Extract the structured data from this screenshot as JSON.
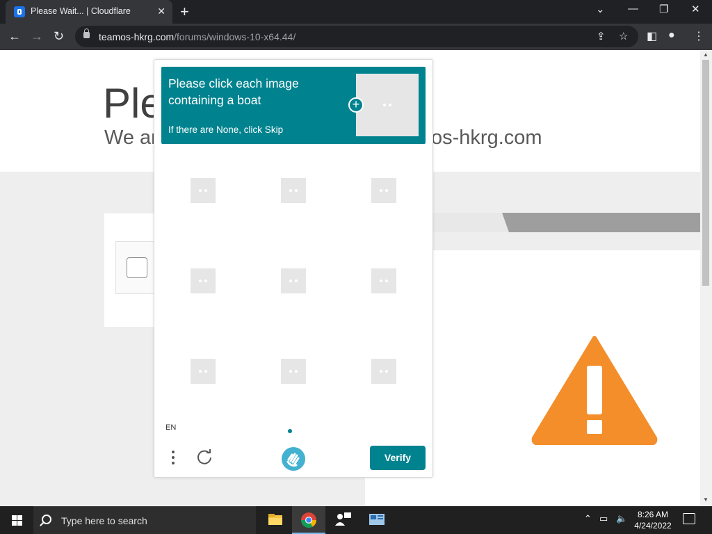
{
  "browser": {
    "tab_title": "Please Wait... | Cloudflare",
    "url_domain": "teamos-hkrg.com",
    "url_path": "/forums/windows-10-x64.44/"
  },
  "page": {
    "heading_partial": "Ple",
    "subheading_partial": "We ar",
    "subheading_tail": "os-hkrg.com"
  },
  "captcha": {
    "prompt": "Please click each image containing a boat",
    "hint": "If there are None, click Skip",
    "language": "EN",
    "verify_label": "Verify",
    "accent_color": "#00838f",
    "tiles": 9
  },
  "taskbar": {
    "search_placeholder": "Type here to search",
    "time": "8:26 AM",
    "date": "4/24/2022"
  }
}
